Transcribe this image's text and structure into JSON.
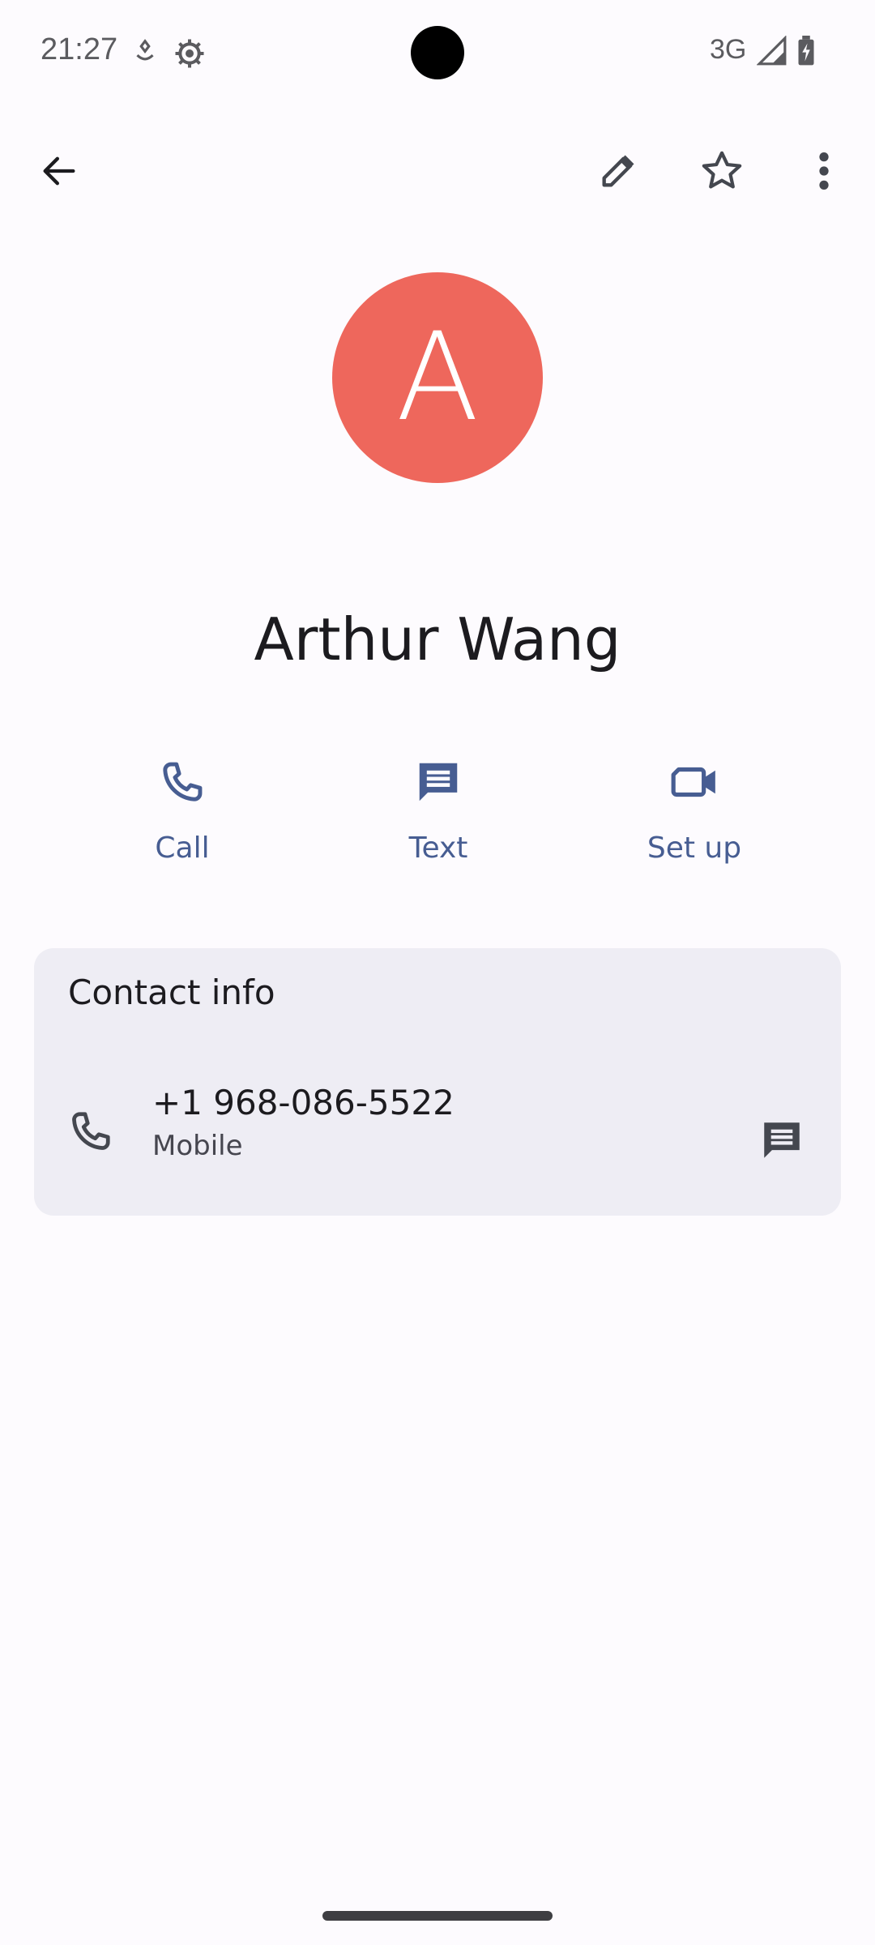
{
  "status_bar": {
    "time": "21:27",
    "network": "3G",
    "icons": [
      "location-icon",
      "settings-gear-icon",
      "signal-icon",
      "battery-charging-icon"
    ]
  },
  "app_bar": {
    "back_icon": "arrow-back-icon",
    "edit_icon": "pencil-icon",
    "favorite_icon": "star-outline-icon",
    "more_icon": "more-vert-icon"
  },
  "contact": {
    "initial": "A",
    "name": "Arthur Wang",
    "avatar_color": "#ee675c"
  },
  "actions": [
    {
      "label": "Call",
      "icon": "phone-icon"
    },
    {
      "label": "Text",
      "icon": "message-icon"
    },
    {
      "label": "Set up",
      "icon": "videocam-icon"
    }
  ],
  "contact_info": {
    "title": "Contact info",
    "phone": {
      "number": "+1 968-086-5522",
      "type": "Mobile",
      "icon": "phone-icon",
      "message_icon": "message-icon"
    }
  },
  "colors": {
    "accent": "#475d92",
    "background": "#fdfbfe",
    "card": "#eeedf4"
  }
}
